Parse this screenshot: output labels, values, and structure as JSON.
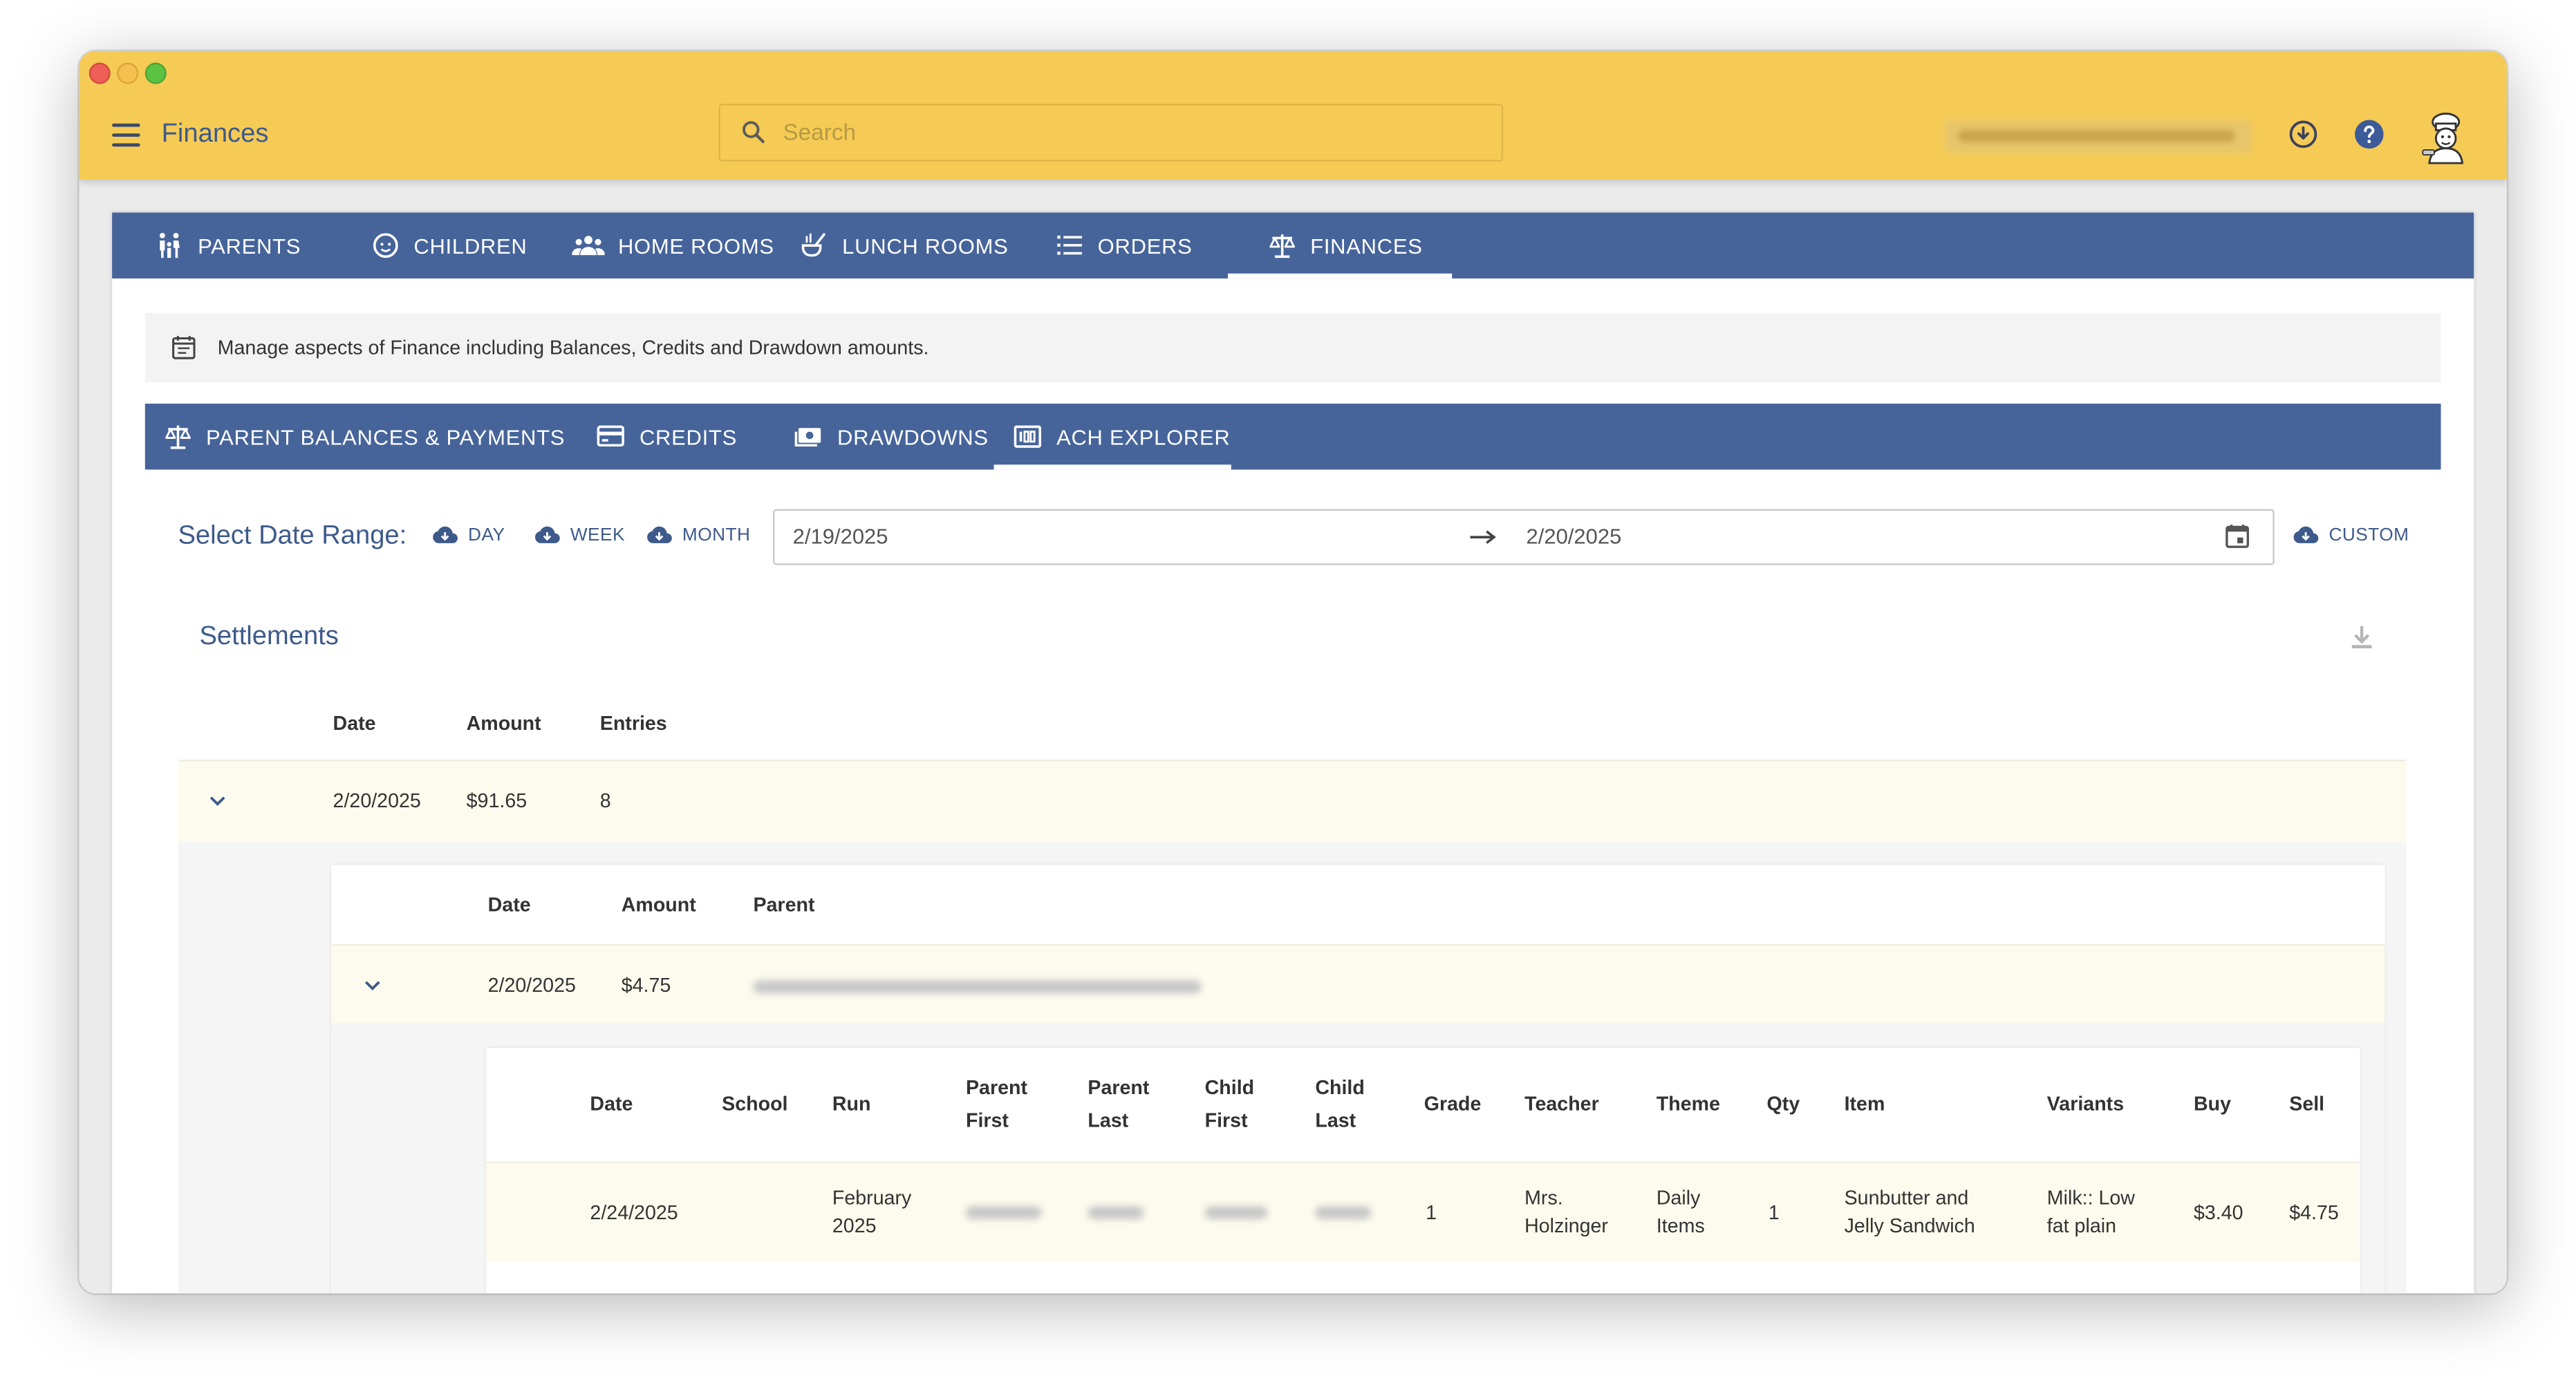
{
  "app": {
    "title": "Finances",
    "search_placeholder": "Search"
  },
  "main_tabs": [
    {
      "label": "PARENTS",
      "icon": "family-icon"
    },
    {
      "label": "CHILDREN",
      "icon": "child-face-icon"
    },
    {
      "label": "HOME ROOMS",
      "icon": "group-icon"
    },
    {
      "label": "LUNCH ROOMS",
      "icon": "soup-icon"
    },
    {
      "label": "ORDERS",
      "icon": "list-icon"
    },
    {
      "label": "FINANCES",
      "icon": "scale-icon",
      "active": true
    }
  ],
  "info": {
    "text": "Manage aspects of Finance including Balances, Credits and Drawdown amounts."
  },
  "sub_tabs": [
    {
      "label": "PARENT BALANCES & PAYMENTS",
      "icon": "scale-icon"
    },
    {
      "label": "CREDITS",
      "icon": "credit-card-icon"
    },
    {
      "label": "DRAWDOWNS",
      "icon": "cash-icon"
    },
    {
      "label": "ACH EXPLORER",
      "icon": "ach-icon",
      "active": true
    }
  ],
  "date_range": {
    "label": "Select Date Range:",
    "day": "DAY",
    "week": "WEEK",
    "month": "MONTH",
    "start": "2/19/2025",
    "end": "2/20/2025",
    "custom": "CUSTOM"
  },
  "settlements": {
    "title": "Settlements",
    "headers": [
      "Date",
      "Amount",
      "Entries"
    ],
    "row": {
      "date": "2/20/2025",
      "amount": "$91.65",
      "entries": "8"
    },
    "entries": {
      "headers": [
        "Date",
        "Amount",
        "Parent"
      ],
      "row": {
        "date": "2/20/2025",
        "amount": "$4.75"
      },
      "items": {
        "headers": {
          "date": "Date",
          "school": "School",
          "run": "Run",
          "parent_first_1": "Parent",
          "parent_first_2": "First",
          "parent_last_1": "Parent",
          "parent_last_2": "Last",
          "child_first_1": "Child",
          "child_first_2": "First",
          "child_last_1": "Child",
          "child_last_2": "Last",
          "grade": "Grade",
          "teacher": "Teacher",
          "theme": "Theme",
          "qty": "Qty",
          "item": "Item",
          "variants": "Variants",
          "buy": "Buy",
          "sell": "Sell"
        },
        "row": {
          "date": "2/24/2025",
          "run_1": "February",
          "run_2": "2025",
          "grade": "1",
          "teacher_1": "Mrs.",
          "teacher_2": "Holzinger",
          "theme_1": "Daily",
          "theme_2": "Items",
          "qty": "1",
          "item_1": "Sunbutter and",
          "item_2": "Jelly Sandwich",
          "variants_1": "Milk:: Low",
          "variants_2": "fat plain",
          "buy": "$3.40",
          "sell": "$4.75"
        }
      }
    }
  }
}
